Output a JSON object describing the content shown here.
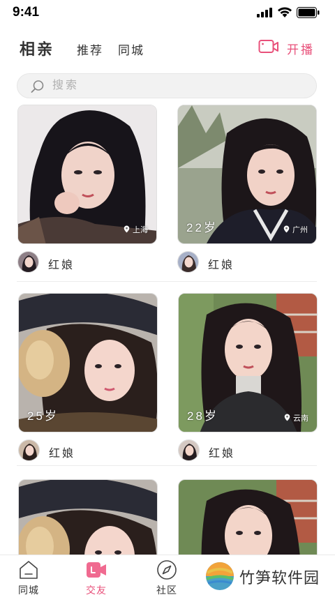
{
  "status_bar": {
    "time": "9:41"
  },
  "header": {
    "title": "相亲",
    "tabs": [
      {
        "label": "推荐"
      },
      {
        "label": "同城"
      }
    ],
    "live_label": "开播"
  },
  "search": {
    "placeholder": "搜索"
  },
  "profiles": [
    {
      "age": "",
      "city": "上海",
      "matchmaker": "红娘"
    },
    {
      "age": "22岁",
      "city": "广州",
      "matchmaker": "红娘"
    },
    {
      "age": "25岁",
      "city": "",
      "matchmaker": "红娘"
    },
    {
      "age": "28岁",
      "city": "云南",
      "matchmaker": "红娘"
    }
  ],
  "bottom_nav": [
    {
      "label": "同城",
      "icon": "home-icon",
      "active": false
    },
    {
      "label": "交友",
      "icon": "video-icon",
      "active": true
    },
    {
      "label": "社区",
      "icon": "compass-icon",
      "active": false
    }
  ],
  "colors": {
    "accent": "#e8507a",
    "text": "#333333",
    "search_bg": "#f2f2f2"
  },
  "watermark": {
    "text": "竹笋软件园"
  }
}
